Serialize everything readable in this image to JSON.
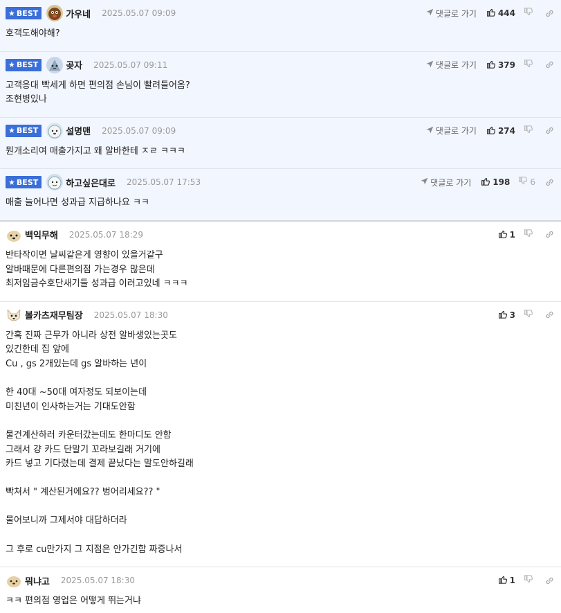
{
  "colors": {
    "best_bg": "#f2f6fe",
    "badge": "#3a6ed8",
    "date": "#999999",
    "divider": "#dfe3ea"
  },
  "icons": {
    "badge_star": "star-icon",
    "reply": "send-arrow-icon",
    "like": "thumbs-up-icon",
    "dislike": "thumbs-down-icon",
    "link": "link-icon"
  },
  "comments": [
    {
      "best": true,
      "badge": "BEST",
      "nick": "가우네",
      "date": "2025.05.07 09:09",
      "reply_label": "댓글로 가기",
      "likes": "444",
      "dislikes": "",
      "lines": [
        "호객도해야해?"
      ]
    },
    {
      "best": true,
      "badge": "BEST",
      "nick": "곶자",
      "date": "2025.05.07 09:11",
      "reply_label": "댓글로 가기",
      "likes": "379",
      "dislikes": "",
      "lines": [
        "고객응대 빡세게 하면 편의점 손님이 빨려들어옴?",
        "조현병있나"
      ]
    },
    {
      "best": true,
      "badge": "BEST",
      "nick": "설명맨",
      "date": "2025.05.07 09:09",
      "reply_label": "댓글로 가기",
      "likes": "274",
      "dislikes": "",
      "lines": [
        "뭔개소리여 매출가지고 왜 알바한테 ㅈㄹ ㅋㅋㅋ"
      ]
    },
    {
      "best": true,
      "badge": "BEST",
      "nick": "하고싶은대로",
      "date": "2025.05.07 17:53",
      "reply_label": "댓글로 가기",
      "likes": "198",
      "dislikes": "6",
      "lines": [
        "매출 늘어나면 성과급 지급하나요 ㅋㅋ"
      ]
    },
    {
      "best": false,
      "nick": "백익무해",
      "date": "2025.05.07 18:29",
      "likes": "1",
      "dislikes": "",
      "lines": [
        "반타작이면 날씨같은게 영향이 있을거같구",
        "알바때문에 다른편의점 가는경우 많은데",
        "최저임금수호단새기들 성과급 이러고있네 ㅋㅋㅋ"
      ]
    },
    {
      "best": false,
      "nick": "볼카츠재무팀장",
      "date": "2025.05.07 18:30",
      "likes": "3",
      "dislikes": "",
      "lines": [
        "간혹 진짜 근무가 아니라 상전 알바생있는곳도",
        "있긴한데 집 앞에",
        "Cu , gs 2개있는데 gs 알바하는 년이",
        "",
        "한 40대 ~50대 여자정도 되보이는데",
        "미친년이 인사하는거는 기대도안함",
        "",
        "물건계산하러 카운터갔는데도 한마디도 안함",
        "그래서 걍 카드 단말기 꼬라보길래 거기에",
        "카드 넣고 기다렸는데 결제 끝났다는 말도안하길래",
        "",
        "빡쳐서 \" 계산된거에요?? 벙어리세요?? \"",
        "",
        "물어보니까 그제서야 대답하더라",
        "",
        "그 후로 cu만가지 그 지점은 안가긴함 짜증나서"
      ]
    },
    {
      "best": false,
      "nick": "뭐냐고",
      "date": "2025.05.07 18:30",
      "likes": "1",
      "dislikes": "",
      "lines": [
        "ㅋㅋ 편의점 영업은 어떻게 뛰는거냐"
      ]
    }
  ]
}
